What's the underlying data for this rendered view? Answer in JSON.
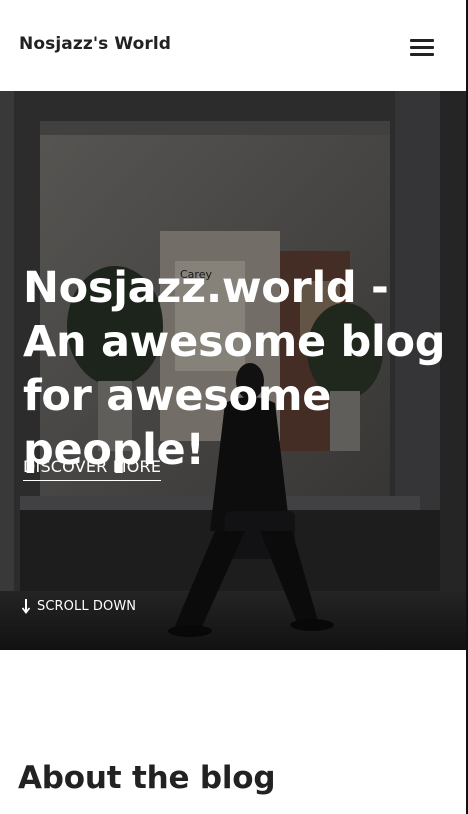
{
  "header": {
    "site_title": "Nosjazz's World",
    "menu_icon": "hamburger-menu-icon"
  },
  "hero": {
    "title": "Nosjazz.world - An awesome blog for awesome people!",
    "cta_label": "DISCOVER MORE",
    "scroll_label": "SCROLL DOWN",
    "scroll_icon": "arrow-down-icon",
    "background_image": "person walking past a storefront window",
    "window_sign_text": "Carey"
  },
  "about": {
    "title": "About the blog"
  },
  "colors": {
    "text_dark": "#222222",
    "hero_text": "#ffffff",
    "background": "#ffffff"
  }
}
